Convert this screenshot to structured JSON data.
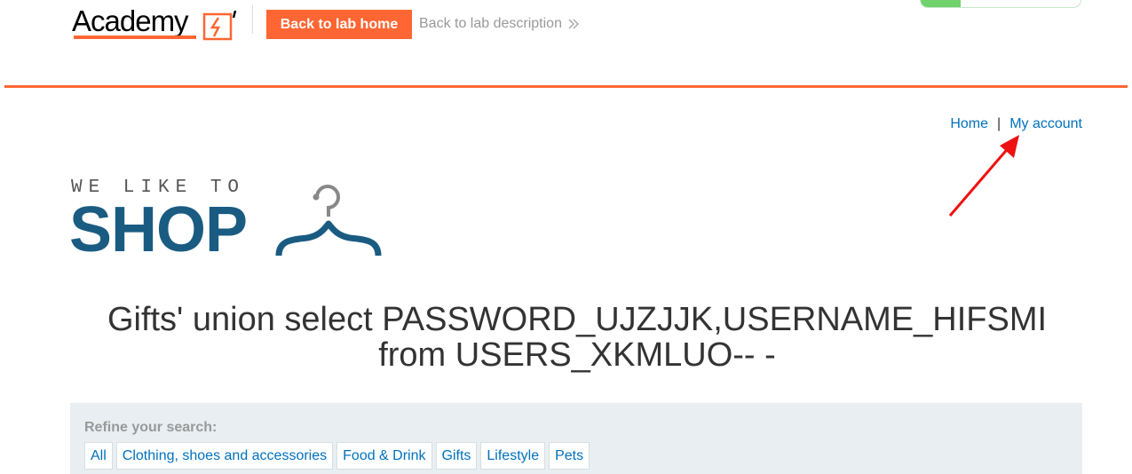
{
  "academy_header": {
    "logo_text": "Academy",
    "back_to_lab_home": "Back to lab home",
    "back_to_lab_description": "Back to lab description",
    "lab_status_progress": 0.25,
    "colors": {
      "accent": "#ff6633",
      "status": "#70d16d"
    }
  },
  "nav": {
    "home": "Home",
    "separator": "|",
    "my_account": "My account"
  },
  "shop_logo": {
    "tagline": "WE LIKE TO",
    "name": "SHOP",
    "icon": "hanger-icon"
  },
  "page": {
    "title_line1": "Gifts' union select PASSWORD_UJZJJK,USERNAME_HIFSMI",
    "title_line2": "from USERS_XKMLUO-- -"
  },
  "filter": {
    "label": "Refine your search:",
    "categories": [
      "All",
      "Clothing, shoes and accessories",
      "Food & Drink",
      "Gifts",
      "Lifestyle",
      "Pets"
    ]
  },
  "annotation": {
    "icon": "red-arrow-icon",
    "color": "#ee1111"
  }
}
